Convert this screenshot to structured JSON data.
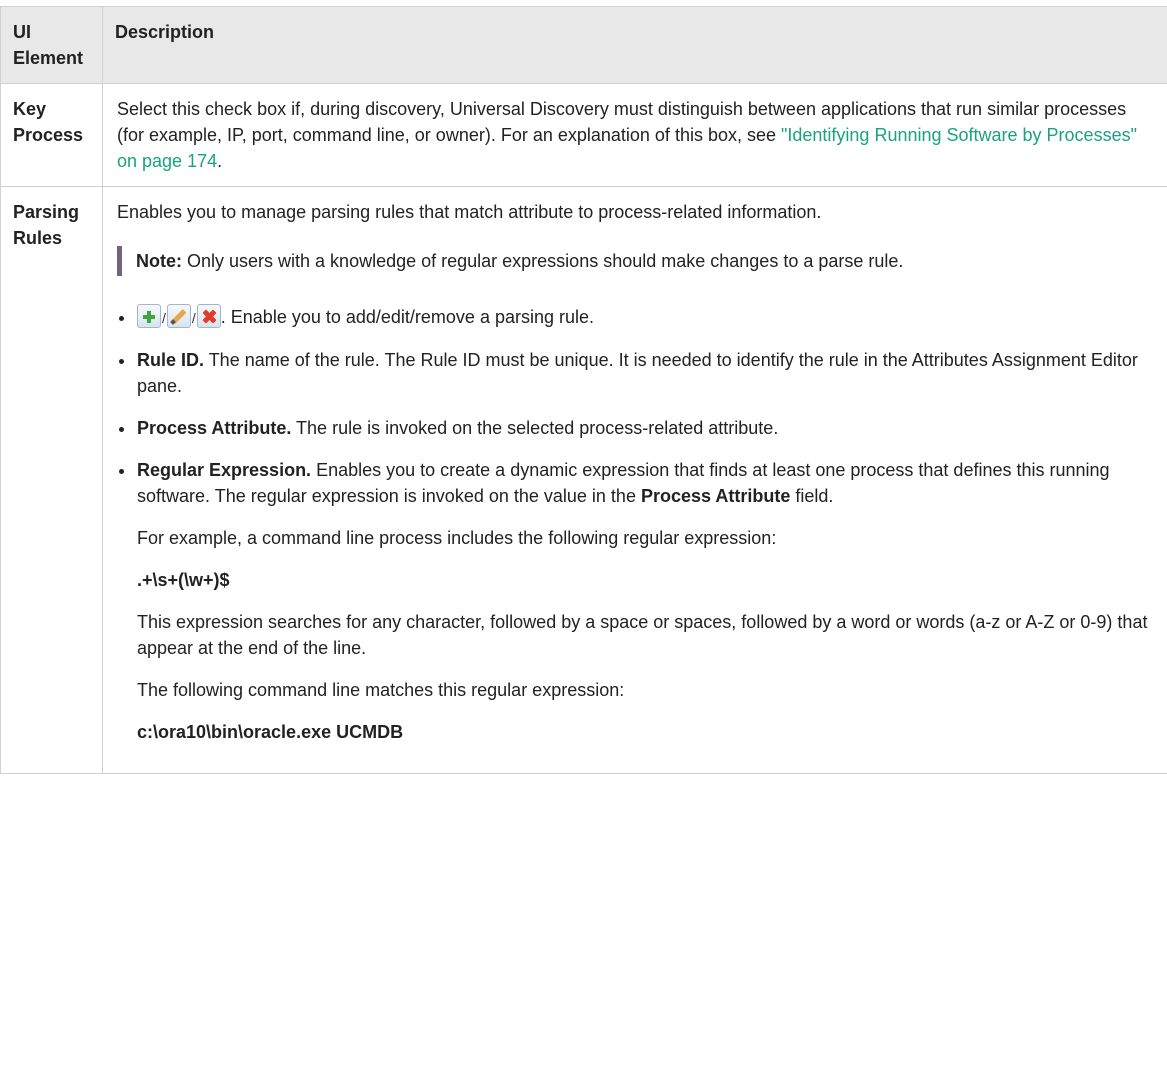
{
  "table": {
    "headers": {
      "ui_element": "UI Element",
      "description": "Description"
    },
    "key_process": {
      "name": "Key Process",
      "text": "Select this check box if, during discovery, Universal Discovery must distinguish between applications that run similar processes (for example, IP, port, command line, or owner). For an explanation of this box, see ",
      "link": "\"Identifying Running Software by Processes\" on page 174",
      "end": "."
    },
    "parsing_rules": {
      "name": "Parsing Rules",
      "intro": "Enables you to manage parsing rules that match attribute to process-related information.",
      "note_label": "Note:",
      "note_text": " Only users with a knowledge of regular expressions should make changes to a parse rule.",
      "icons": [
        "add-icon",
        "edit-icon",
        "remove-icon"
      ],
      "icons_text": ". Enable you to add/edit/remove a parsing rule.",
      "rule_id_label": "Rule ID.",
      "rule_id_text": " The name of the rule. The Rule ID must be unique. It is needed to identify the rule in the Attributes Assignment Editor pane.",
      "process_attr_label": "Process Attribute.",
      "process_attr_text": " The rule is invoked on the selected process-related attribute.",
      "regex_label": "Regular Expression.",
      "regex_text_a": " Enables you to create a dynamic expression that finds at least one process that defines this running software. The regular expression is invoked on the value in the ",
      "regex_text_b": "Process Attribute",
      "regex_text_c": " field.",
      "example_intro": "For example, a command line process includes the following regular expression:",
      "example_regex": ".+\\s+(\\w+)$",
      "example_explain": "This expression searches for any character, followed by a space or spaces, followed by a word or words (a-z or A-Z or 0-9) that appear at the end of the line.",
      "match_intro": "The following command line matches this regular expression:",
      "match_example": "c:\\ora10\\bin\\oracle.exe UCMDB"
    }
  }
}
